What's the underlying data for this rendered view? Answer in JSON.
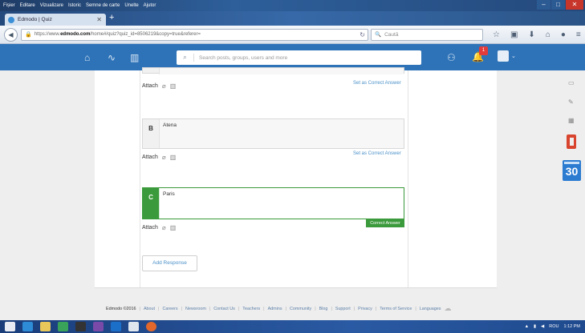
{
  "browser": {
    "menu": [
      "Fișier",
      "Editare",
      "Vizualizare",
      "Istoric",
      "Semne de carte",
      "Unelte",
      "Ajutor"
    ],
    "tab_title": "Edmodo | Quiz",
    "url_prefix": "https://www.",
    "url_host": "edmodo.com",
    "url_path": "/home#/quiz?quiz_id=8506219&copy=true&referer=",
    "search_placeholder": "Caută"
  },
  "edmodo": {
    "search_placeholder": "Search posts, groups, users and more",
    "notification_count": "1"
  },
  "quiz": {
    "attach_label": "Attach",
    "set_correct_label": "Set as Correct Answer",
    "correct_answer_label": "Correct Answer",
    "add_response_label": "Add Response",
    "options": [
      {
        "letter": "B",
        "text": "Atena"
      },
      {
        "letter": "C",
        "text": "Paris"
      }
    ]
  },
  "side_widgets": {
    "calendar_day": "30"
  },
  "footer": {
    "copyright": "Edmodo ©2016",
    "links": [
      "About",
      "Careers",
      "Newsroom",
      "Contact Us",
      "Teachers",
      "Admins",
      "Community",
      "Blog",
      "Support",
      "Privacy",
      "Terms of Service",
      "Languages"
    ]
  },
  "taskbar": {
    "lang": "ROU",
    "time": "1:12 PM"
  }
}
